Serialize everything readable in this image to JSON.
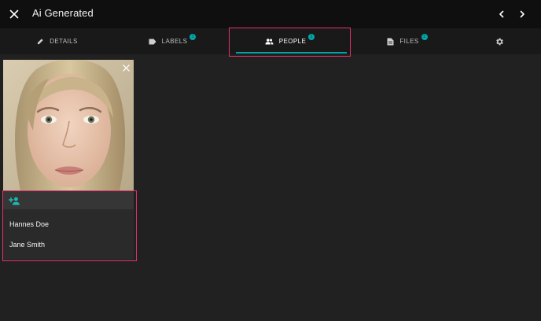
{
  "window": {
    "title": "Ai Generated",
    "close_icon": "close-icon",
    "prev_icon": "chevron-left-icon",
    "next_icon": "chevron-right-icon"
  },
  "tabs": [
    {
      "id": "details",
      "label": "DETAILS",
      "icon": "pencil-icon",
      "badge": null,
      "active": false
    },
    {
      "id": "labels",
      "label": "LABELS",
      "icon": "label-icon",
      "badge": "1",
      "active": false
    },
    {
      "id": "people",
      "label": "PEOPLE",
      "icon": "people-icon",
      "badge": "1",
      "active": true
    },
    {
      "id": "files",
      "label": "FILES",
      "icon": "files-icon",
      "badge": "1",
      "active": false
    },
    {
      "id": "settings",
      "label": "",
      "icon": "gear-icon",
      "badge": null,
      "active": false
    }
  ],
  "people_panel": {
    "photo_icon": "face-photo",
    "remove_icon": "close-icon",
    "add_person_icon": "person-add-icon",
    "names": [
      "Hannes Doe",
      "Jane Smith"
    ]
  },
  "colors": {
    "accent": "#00a6a6",
    "highlight": "#e8306e",
    "background": "#212121",
    "topbar": "#0f0f0f"
  }
}
